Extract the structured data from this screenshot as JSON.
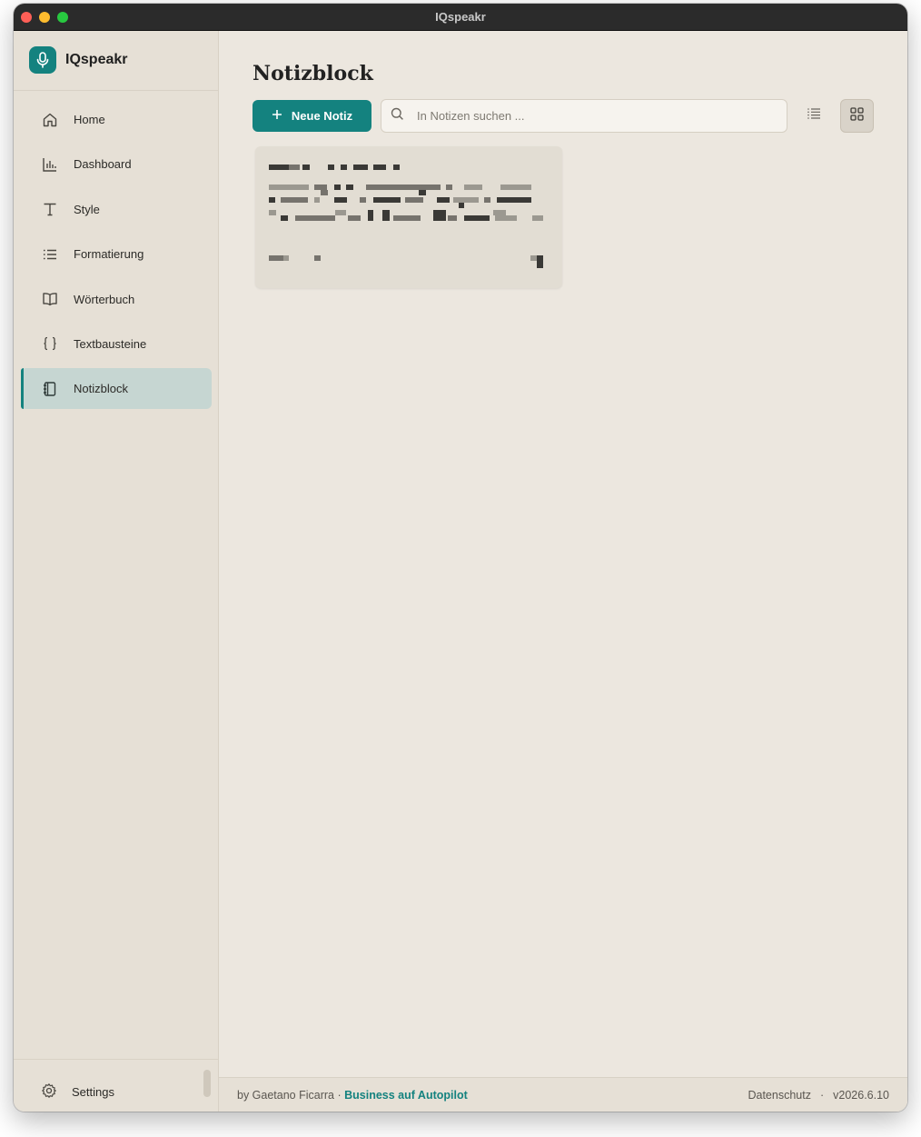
{
  "window": {
    "title": "IQspeakr"
  },
  "brand": {
    "name": "IQspeakr",
    "icon": "microphone-icon",
    "accent": "#14827f"
  },
  "sidebar": {
    "items": [
      {
        "label": "Home",
        "icon": "home-icon",
        "active": false
      },
      {
        "label": "Dashboard",
        "icon": "bar-chart-icon",
        "active": false
      },
      {
        "label": "Style",
        "icon": "text-t-icon",
        "active": false
      },
      {
        "label": "Formatierung",
        "icon": "list-icon",
        "active": false
      },
      {
        "label": "Wörterbuch",
        "icon": "book-icon",
        "active": false
      },
      {
        "label": "Textbausteine",
        "icon": "braces-icon",
        "active": false
      },
      {
        "label": "Notizblock",
        "icon": "notebook-icon",
        "active": true
      }
    ],
    "settings_label": "Settings"
  },
  "main": {
    "title": "Notizblock",
    "new_note_label": "Neue Notiz",
    "search_placeholder": "In Notizen suchen ...",
    "view_mode": "grid"
  },
  "footer": {
    "by_text": "by Gaetano Ficarra · ",
    "link_text": "Business auf Autopilot",
    "privacy_label": "Datenschutz",
    "separator": "·",
    "version": "v2026.6.10"
  }
}
